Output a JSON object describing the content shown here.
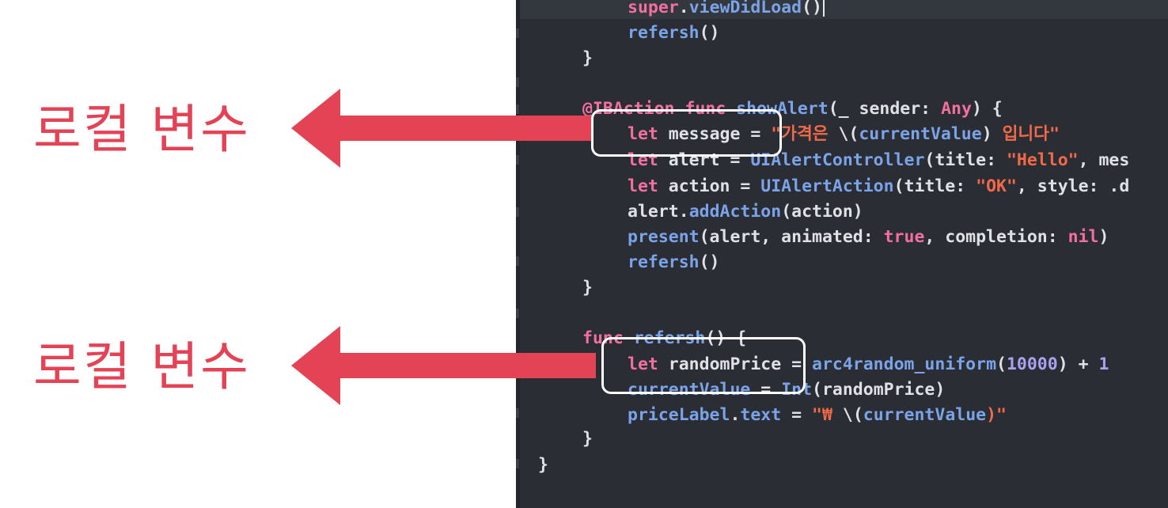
{
  "annotations": {
    "label_top": "로컬 변수",
    "label_bottom": "로컬 변수",
    "arrow_color": "#e34355",
    "highlight_color": "#ffffff"
  },
  "editor": {
    "background": "#2a2d33",
    "lines": {
      "l1": {
        "a": "super",
        "b": ".",
        "c": "viewDidLoad",
        "d": "()"
      },
      "l2": {
        "a": "refersh",
        "b": "()"
      },
      "l3": {
        "a": "}"
      },
      "l4": {
        "a": "@IBAction",
        "b": " ",
        "c": "func",
        "d": " ",
        "e": "showAlert",
        "f": "(_ sender: ",
        "g": "Any",
        "h": ") {"
      },
      "l5": {
        "a": "let",
        "b": " message = ",
        "c": "\"가격은 ",
        "d": "\\(",
        "e": "currentValue",
        "f": ")",
        "g": " 입니다\""
      },
      "l6": {
        "a": "let",
        "b": " alert = ",
        "c": "UIAlertController",
        "d": "(title: ",
        "e": "\"Hello\"",
        "f": ", mes"
      },
      "l7": {
        "a": "let",
        "b": " action = ",
        "c": "UIAlertAction",
        "d": "(title: ",
        "e": "\"OK\"",
        "f": ", style: .d"
      },
      "l8": {
        "a": "alert",
        "b": ".",
        "c": "addAction",
        "d": "(action)"
      },
      "l9": {
        "a": "present",
        "b": "(alert, animated: ",
        "c": "true",
        "d": ", completion: ",
        "e": "nil",
        "f": ")"
      },
      "l10": {
        "a": "refersh",
        "b": "()"
      },
      "l11": {
        "a": "}"
      },
      "l12": {
        "a": "func",
        "b": " ",
        "c": "refersh",
        "d": "() {"
      },
      "l13": {
        "a": "let",
        "b": " randomPrice = ",
        "c": "arc4random_uniform",
        "d": "(",
        "e": "10000",
        "f": ") + ",
        "g": "1"
      },
      "l14": {
        "a": "currentValue",
        "b": " = ",
        "c": "Int",
        "d": "(randomPrice)"
      },
      "l15": {
        "a": "priceLabel",
        "b": ".",
        "c": "text",
        "d": " = ",
        "e": "\"₩ ",
        "f": "\\(",
        "g": "currentValue",
        "h": ")\""
      },
      "l16": {
        "a": "}"
      },
      "l17": {
        "a": "}"
      }
    }
  }
}
